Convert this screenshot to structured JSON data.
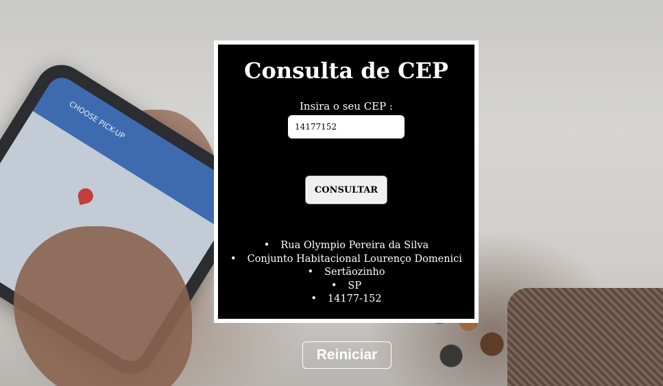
{
  "card": {
    "title": "Consulta de CEP",
    "cep_label": "Insira o seu CEP :",
    "cep_value": "14177152",
    "consultar_label": "CONSULTAR",
    "results": [
      "Rua Olympio Pereira da Silva",
      "Conjunto Habitacional Lourenço Domenici",
      "Sertãozinho",
      "SP",
      "14177-152"
    ]
  },
  "reiniciar_label": "Reiniciar",
  "background": {
    "phone_screen_label": "CHOOSE PICK-UP"
  },
  "colors": {
    "card_bg": "#000000",
    "card_border": "#ffffff",
    "button_bg": "#f0f0f0"
  }
}
